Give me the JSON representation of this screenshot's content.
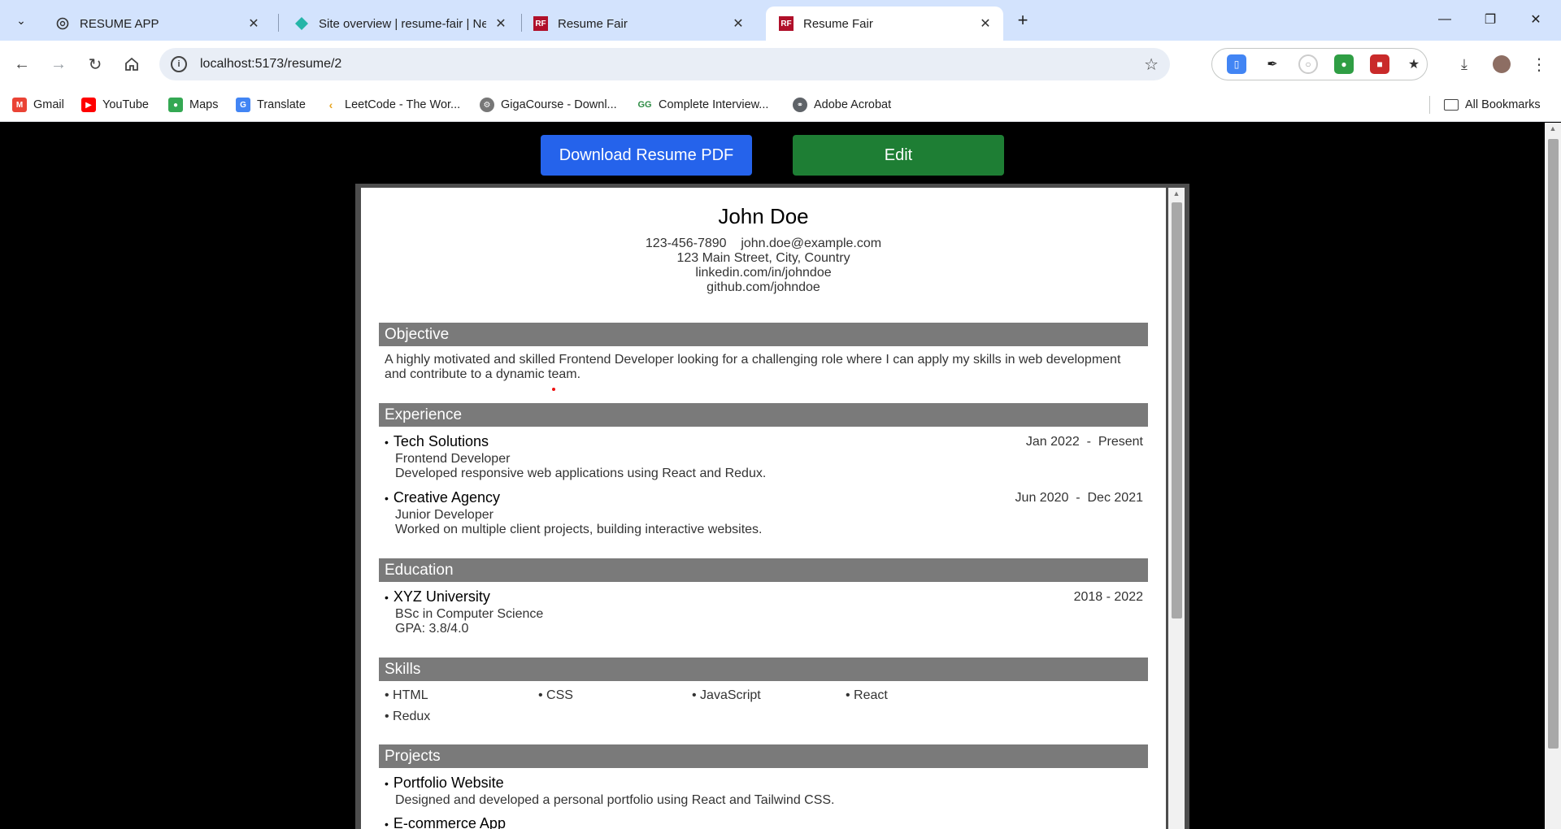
{
  "browser": {
    "tabs": [
      {
        "title": "RESUME APP",
        "favicon": "chatgpt-icon"
      },
      {
        "title": "Site overview | resume-fair | Ne",
        "favicon": "netlify-icon"
      },
      {
        "title": "Resume Fair",
        "favicon": "rf-logo",
        "favicon_text": "RF"
      },
      {
        "title": "Resume Fair",
        "favicon": "rf-logo",
        "favicon_text": "RF"
      }
    ],
    "url": "localhost:5173/resume/2",
    "bookmarks": [
      {
        "label": "Gmail",
        "icon": "gmail-icon"
      },
      {
        "label": "YouTube",
        "icon": "youtube-icon"
      },
      {
        "label": "Maps",
        "icon": "maps-icon"
      },
      {
        "label": "Translate",
        "icon": "translate-icon"
      },
      {
        "label": "LeetCode - The Wor...",
        "icon": "leetcode-icon"
      },
      {
        "label": "GigaCourse - Downl...",
        "icon": "gigacourse-icon"
      },
      {
        "label": "Complete Interview...",
        "icon": "gfg-icon"
      },
      {
        "label": "Adobe Acrobat",
        "icon": "globe-icon"
      }
    ],
    "all_bookmarks": "All Bookmarks"
  },
  "page": {
    "download_label": "Download Resume PDF",
    "edit_label": "Edit",
    "colors": {
      "download": "#2563eb",
      "edit": "#1e7e34",
      "section_header": "#7a7a7a"
    }
  },
  "resume": {
    "name": "John Doe",
    "phone": "123-456-7890",
    "email": "john.doe@example.com",
    "address": "123 Main Street, City, Country",
    "linkedin": "linkedin.com/in/johndoe",
    "github": "github.com/johndoe",
    "sections": {
      "objective": "Objective",
      "experience": "Experience",
      "education": "Education",
      "skills": "Skills",
      "projects": "Projects"
    },
    "objective": "A highly motivated and skilled Frontend Developer looking for a challenging role where I can apply my skills in web development and contribute to a dynamic team.",
    "experience": [
      {
        "company": "Tech Solutions",
        "start": "Jan 2022",
        "end": "Present",
        "role": "Frontend Developer",
        "desc": "Developed responsive web applications using React and Redux."
      },
      {
        "company": "Creative Agency",
        "start": "Jun 2020",
        "end": "Dec 2021",
        "role": "Junior Developer",
        "desc": "Worked on multiple client projects, building interactive websites."
      }
    ],
    "education": [
      {
        "school": "XYZ University",
        "years": "2018 - 2022",
        "degree": "BSc in Computer Science",
        "gpa": "GPA: 3.8/4.0"
      }
    ],
    "skills": [
      "HTML",
      "CSS",
      "JavaScript",
      "React",
      "Redux"
    ],
    "projects": [
      {
        "name": "Portfolio Website",
        "desc": "Designed and developed a personal portfolio using React and Tailwind CSS."
      },
      {
        "name": "E-commerce App"
      }
    ]
  }
}
